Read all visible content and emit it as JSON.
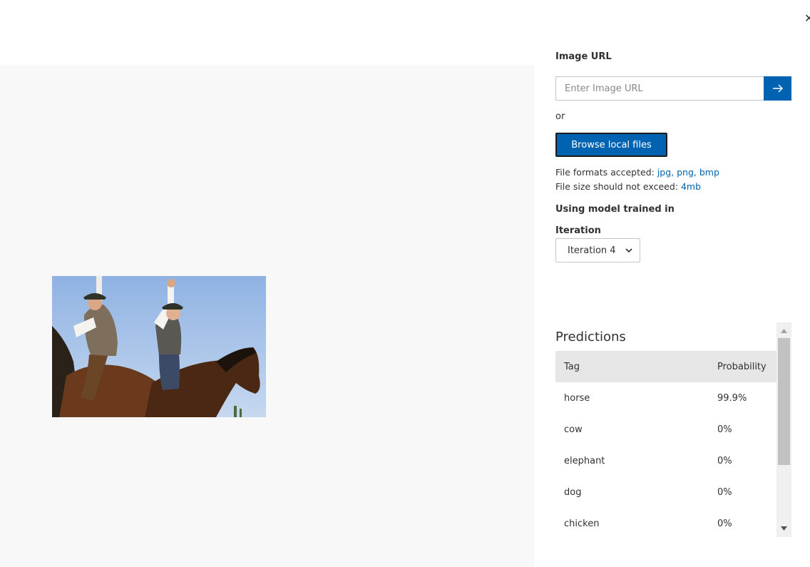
{
  "dialog": {
    "close_label": "✕"
  },
  "image_preview": {
    "alt": "Two riders on horseback raising their arms"
  },
  "form": {
    "image_url_label": "Image URL",
    "image_url_placeholder": "Enter Image URL",
    "or_text": "or",
    "browse_button": "Browse local files",
    "formats_prefix": "File formats accepted: ",
    "formats_value": "jpg, png, bmp",
    "size_prefix": "File size should not exceed: ",
    "size_value": "4mb",
    "model_label": "Using model trained in",
    "iteration_label": "Iteration",
    "iteration_value": "Iteration 4"
  },
  "predictions": {
    "title": "Predictions",
    "columns": {
      "tag": "Tag",
      "probability": "Probability"
    },
    "rows": [
      {
        "tag": "horse",
        "probability": "99.9%"
      },
      {
        "tag": "cow",
        "probability": "0%"
      },
      {
        "tag": "elephant",
        "probability": "0%"
      },
      {
        "tag": "dog",
        "probability": "0%"
      },
      {
        "tag": "chicken",
        "probability": "0%"
      }
    ]
  },
  "colors": {
    "accent": "#0063b1",
    "pane_bg": "#f8f8f8",
    "header_bg": "#e6e6e6"
  }
}
